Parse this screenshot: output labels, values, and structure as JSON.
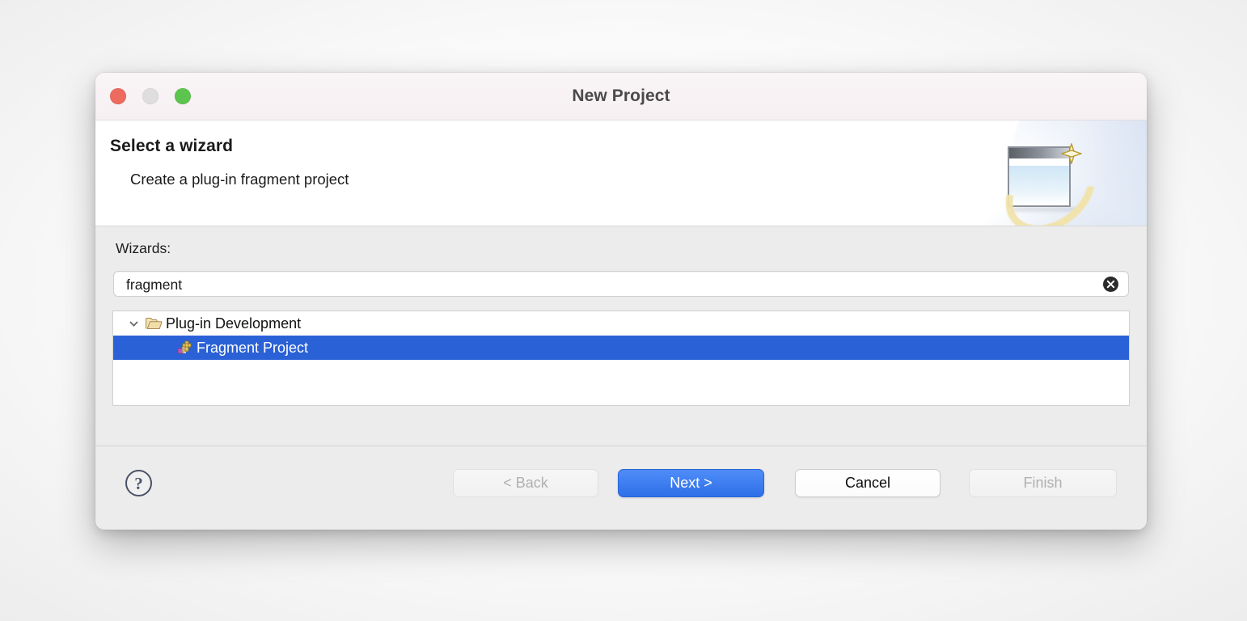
{
  "window": {
    "title": "New Project",
    "traffic_lights": [
      {
        "name": "close",
        "color": "#ec6a5e"
      },
      {
        "name": "minimize",
        "color": "#dedede"
      },
      {
        "name": "maximize",
        "color": "#5cc44f"
      }
    ]
  },
  "header": {
    "title": "Select a wizard",
    "description": "Create a plug-in fragment project",
    "banner_icon": "wizard-window-sparkle-banner"
  },
  "content": {
    "wizards_label": "Wizards:",
    "search": {
      "value": "fragment",
      "placeholder": "type filter text",
      "clear_icon": "clear-circle-icon"
    },
    "tree": [
      {
        "label": "Plug-in Development",
        "icon": "open-folder-icon",
        "twisty": "chevron-down-icon",
        "expanded": true,
        "selected": false,
        "level": 0
      },
      {
        "label": "Fragment Project",
        "icon": "fragment-project-icon",
        "expanded": false,
        "selected": true,
        "level": 1
      }
    ]
  },
  "footer": {
    "help_label": "?",
    "help_icon": "question-mark-circle-icon",
    "buttons": [
      {
        "key": "back",
        "label": "< Back",
        "state": "disabled"
      },
      {
        "key": "next",
        "label": "Next >",
        "state": "primary"
      },
      {
        "key": "cancel",
        "label": "Cancel",
        "state": "normal"
      },
      {
        "key": "finish",
        "label": "Finish",
        "state": "disabled"
      }
    ]
  },
  "colors": {
    "selection_blue": "#2a61d6",
    "primary_button_blue": "#3b7cf0",
    "dialog_bg": "#ececec",
    "titlebar_bg": "#f7f2f4"
  }
}
